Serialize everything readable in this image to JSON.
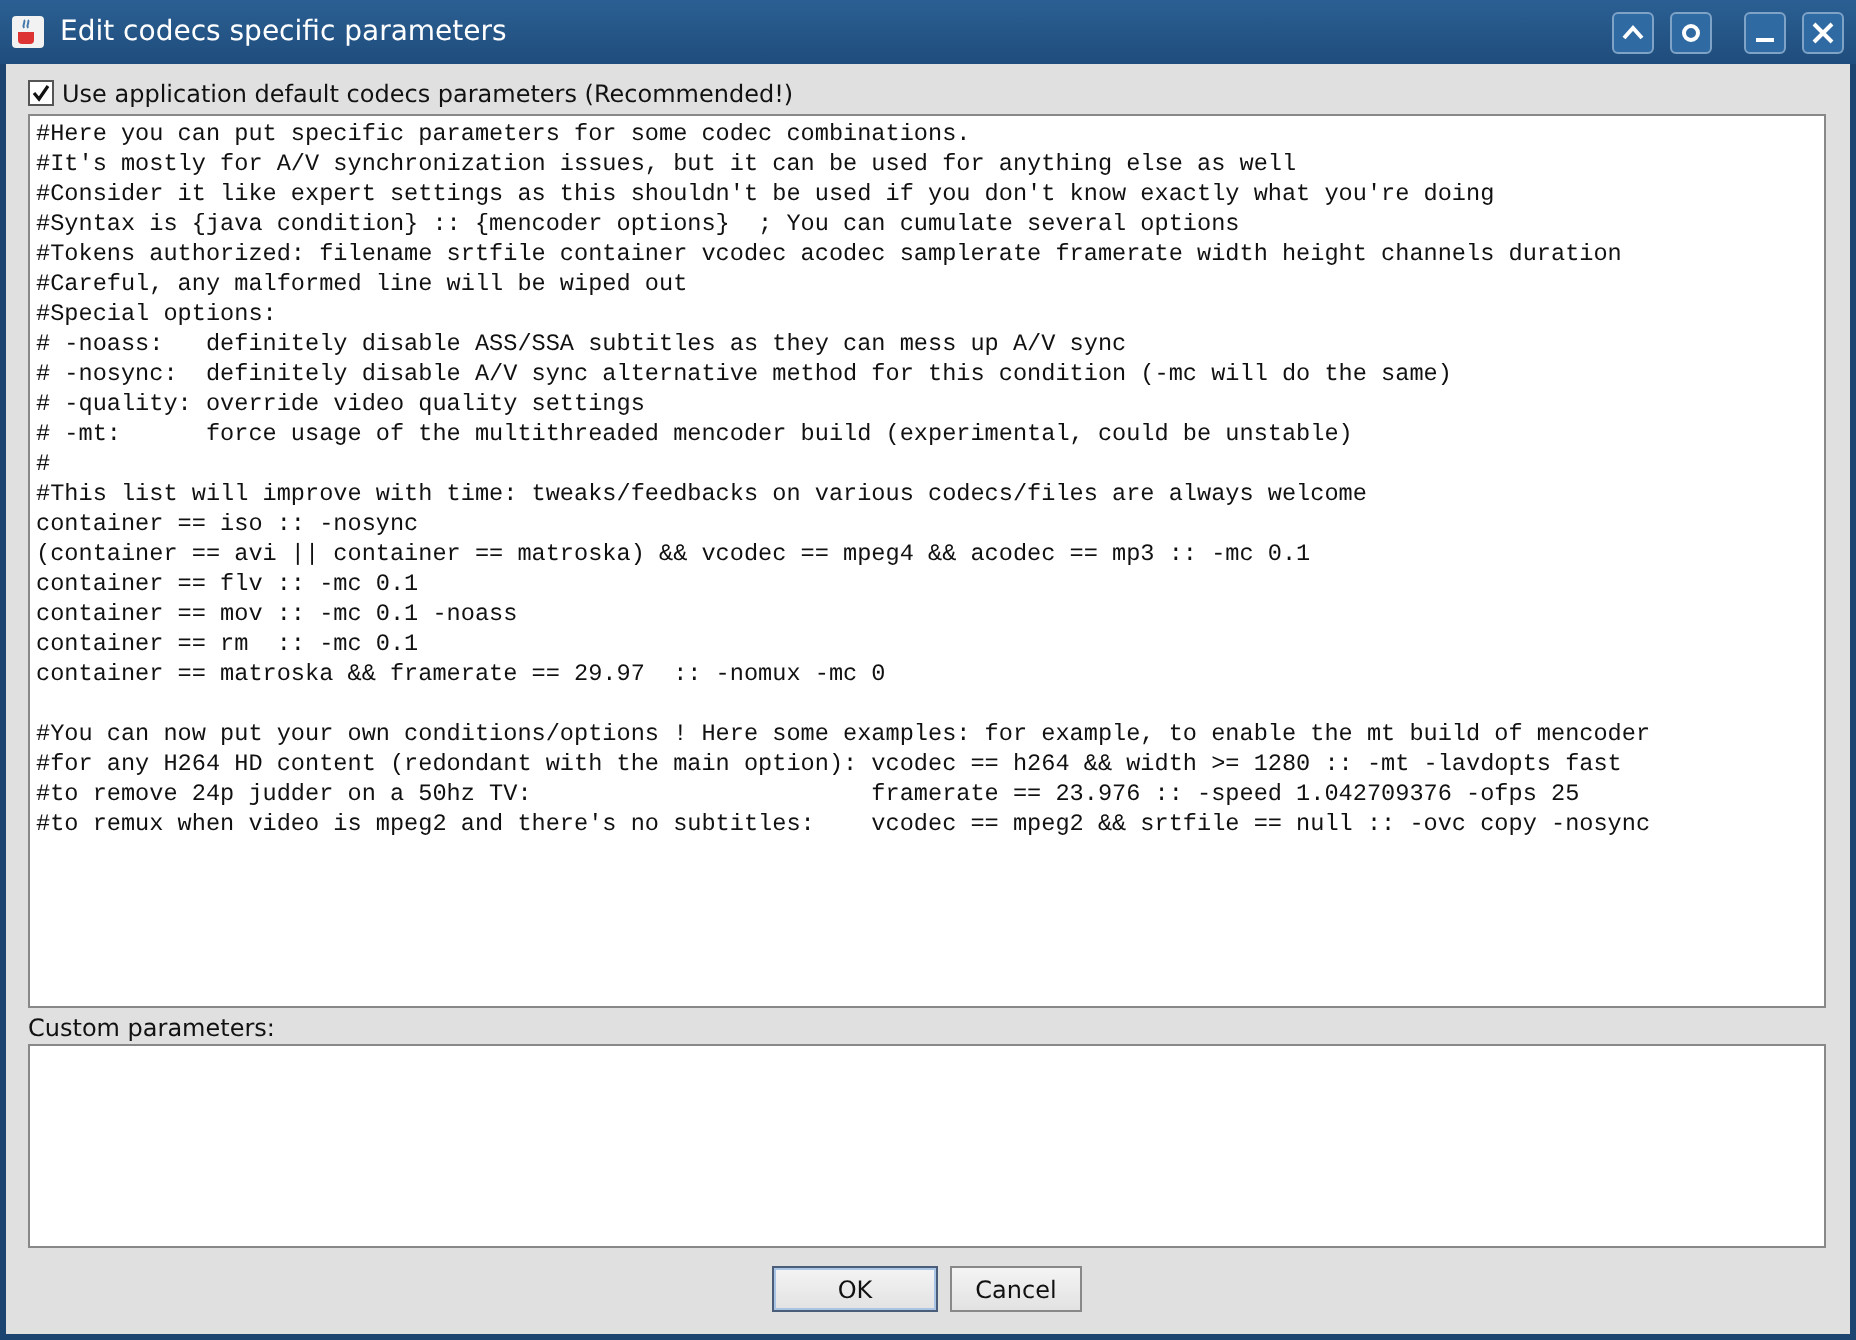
{
  "window": {
    "title": "Edit codecs specific parameters"
  },
  "default_checkbox": {
    "label": "Use application default codecs parameters (Recommended!)",
    "checked": true
  },
  "parameters_text": "#Here you can put specific parameters for some codec combinations.\n#It's mostly for A/V synchronization issues, but it can be used for anything else as well\n#Consider it like expert settings as this shouldn't be used if you don't know exactly what you're doing\n#Syntax is {java condition} :: {mencoder options}  ; You can cumulate several options\n#Tokens authorized: filename srtfile container vcodec acodec samplerate framerate width height channels duration\n#Careful, any malformed line will be wiped out\n#Special options:\n# -noass:   definitely disable ASS/SSA subtitles as they can mess up A/V sync\n# -nosync:  definitely disable A/V sync alternative method for this condition (-mc will do the same)\n# -quality: override video quality settings\n# -mt:      force usage of the multithreaded mencoder build (experimental, could be unstable)\n#\n#This list will improve with time: tweaks/feedbacks on various codecs/files are always welcome\ncontainer == iso :: -nosync\n(container == avi || container == matroska) && vcodec == mpeg4 && acodec == mp3 :: -mc 0.1\ncontainer == flv :: -mc 0.1\ncontainer == mov :: -mc 0.1 -noass\ncontainer == rm  :: -mc 0.1\ncontainer == matroska && framerate == 29.97  :: -nomux -mc 0\n\n#You can now put your own conditions/options ! Here some examples: for example, to enable the mt build of mencoder\n#for any H264 HD content (redondant with the main option): vcodec == h264 && width >= 1280 :: -mt -lavdopts fast\n#to remove 24p judder on a 50hz TV:                        framerate == 23.976 :: -speed 1.042709376 -ofps 25\n#to remux when video is mpeg2 and there's no subtitles:    vcodec == mpeg2 && srtfile == null :: -ovc copy -nosync",
  "custom_label": "Custom parameters:",
  "buttons": [
    {
      "label": "OK",
      "focused": true
    },
    {
      "label": "Cancel",
      "focused": false
    }
  ]
}
